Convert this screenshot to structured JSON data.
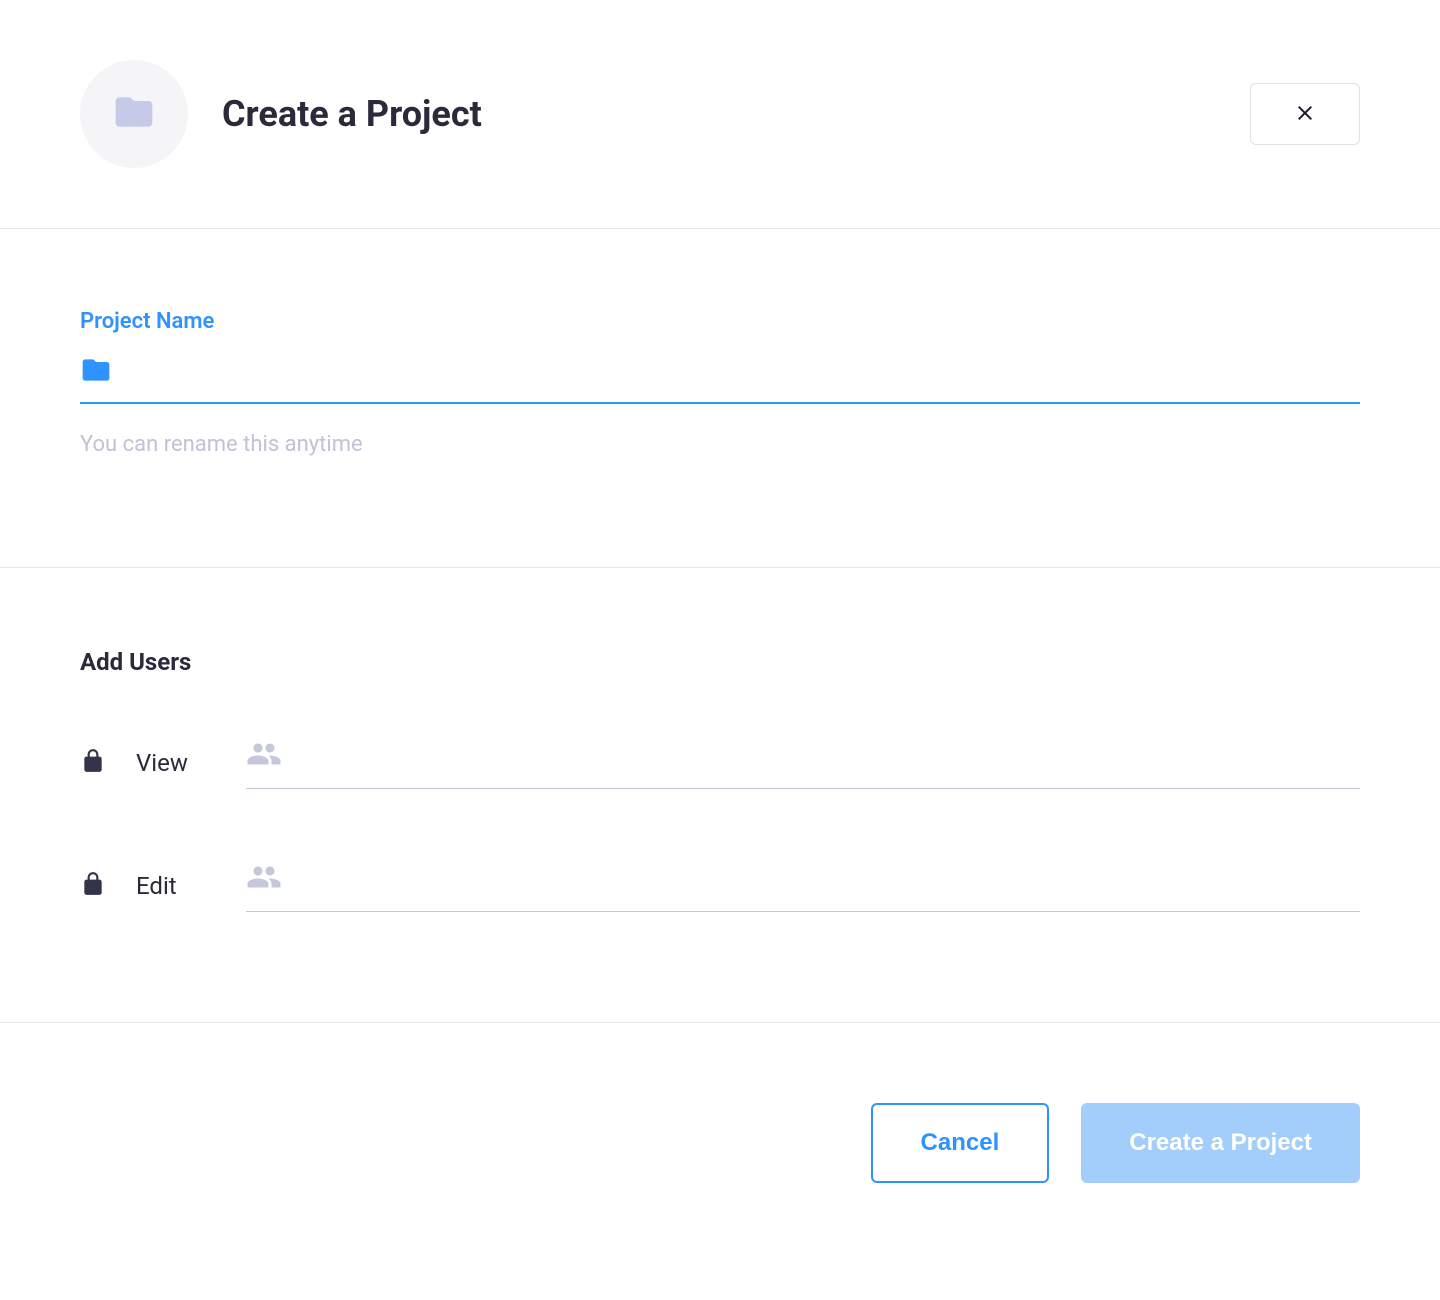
{
  "header": {
    "title": "Create a Project"
  },
  "projectName": {
    "label": "Project Name",
    "value": "",
    "helper": "You can rename this anytime"
  },
  "addUsers": {
    "title": "Add Users",
    "rows": [
      {
        "label": "View"
      },
      {
        "label": "Edit"
      }
    ]
  },
  "footer": {
    "cancel": "Cancel",
    "submit": "Create a Project"
  }
}
